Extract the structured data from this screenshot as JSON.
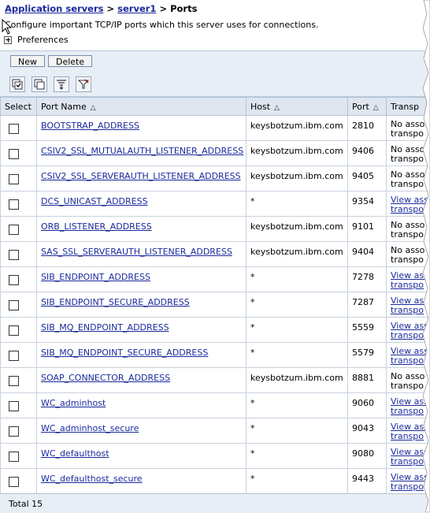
{
  "breadcrumb": {
    "item1": "Application servers",
    "sep1": " > ",
    "item2": "server1",
    "sep2": " > ",
    "current": "Ports"
  },
  "description": "Configure important TCP/IP ports which this server uses for connections.",
  "preferences_label": "Preferences",
  "buttons": {
    "new": "New",
    "delete": "Delete"
  },
  "icons": [
    "select-all-icon",
    "deselect-all-icon",
    "show-filter-icon",
    "clear-filter-icon"
  ],
  "table": {
    "headers": {
      "select": "Select",
      "port_name": "Port Name",
      "host": "Host",
      "port": "Port",
      "transport": "Transp"
    },
    "rows": [
      {
        "name": "BOOTSTRAP_ADDRESS",
        "host": "keysbotzum.ibm.com",
        "port": "2810",
        "transport": "No asso\ntranspo",
        "transport_link": false
      },
      {
        "name": "CSIV2_SSL_MUTUALAUTH_LISTENER_ADDRESS",
        "host": "keysbotzum.ibm.com",
        "port": "9406",
        "transport": "No asso\ntranspo",
        "transport_link": false
      },
      {
        "name": "CSIV2_SSL_SERVERAUTH_LISTENER_ADDRESS",
        "host": "keysbotzum.ibm.com",
        "port": "9405",
        "transport": "No asso\ntranspo",
        "transport_link": false
      },
      {
        "name": "DCS_UNICAST_ADDRESS",
        "host": "*",
        "port": "9354",
        "transport": "View ass\ntranspo",
        "transport_link": true
      },
      {
        "name": "ORB_LISTENER_ADDRESS",
        "host": "keysbotzum.ibm.com",
        "port": "9101",
        "transport": "No asso\ntranspo",
        "transport_link": false
      },
      {
        "name": "SAS_SSL_SERVERAUTH_LISTENER_ADDRESS",
        "host": "keysbotzum.ibm.com",
        "port": "9404",
        "transport": "No asso\ntranspo",
        "transport_link": false
      },
      {
        "name": "SIB_ENDPOINT_ADDRESS",
        "host": "*",
        "port": "7278",
        "transport": "View ass\ntranspo",
        "transport_link": true
      },
      {
        "name": "SIB_ENDPOINT_SECURE_ADDRESS",
        "host": "*",
        "port": "7287",
        "transport": "View ass\ntranspo",
        "transport_link": true
      },
      {
        "name": "SIB_MQ_ENDPOINT_ADDRESS",
        "host": "*",
        "port": "5559",
        "transport": "View ass\ntranspo",
        "transport_link": true
      },
      {
        "name": "SIB_MQ_ENDPOINT_SECURE_ADDRESS",
        "host": "*",
        "port": "5579",
        "transport": "View ass\ntranspo",
        "transport_link": true
      },
      {
        "name": "SOAP_CONNECTOR_ADDRESS",
        "host": "keysbotzum.ibm.com",
        "port": "8881",
        "transport": "No asso\ntranspo",
        "transport_link": false
      },
      {
        "name": "WC_adminhost",
        "host": "*",
        "port": "9060",
        "transport": "View ass\ntranspo",
        "transport_link": true
      },
      {
        "name": "WC_adminhost_secure",
        "host": "*",
        "port": "9043",
        "transport": "View ass\ntranspo",
        "transport_link": true
      },
      {
        "name": "WC_defaulthost",
        "host": "*",
        "port": "9080",
        "transport": "View ass\ntranspo",
        "transport_link": true
      },
      {
        "name": "WC_defaulthost_secure",
        "host": "*",
        "port": "9443",
        "transport": "View ass\ntranspo",
        "transport_link": true
      }
    ]
  },
  "footer": {
    "total": "Total 15"
  },
  "colors": {
    "link": "#1a2a9c",
    "toolbar_bg": "#e8eef6",
    "header_bg": "#dfe6ef",
    "border": "#b6c3d3"
  }
}
